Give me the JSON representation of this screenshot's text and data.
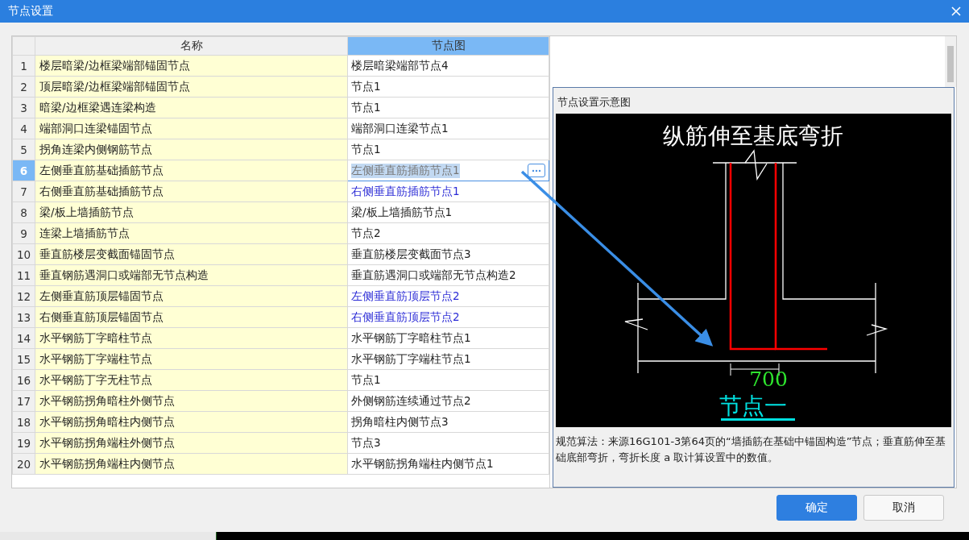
{
  "window": {
    "title": "节点设置"
  },
  "table": {
    "columns": [
      {
        "label": "名称",
        "selected": false
      },
      {
        "label": "节点图",
        "selected": true
      }
    ],
    "rows": [
      {
        "index": "1",
        "name": "楼层暗梁/边框梁端部锚固节点",
        "value": "楼层暗梁端部节点4",
        "modified": false,
        "selected": false
      },
      {
        "index": "2",
        "name": "顶层暗梁/边框梁端部锚固节点",
        "value": "节点1",
        "modified": false,
        "selected": false
      },
      {
        "index": "3",
        "name": "暗梁/边框梁遇连梁构造",
        "value": "节点1",
        "modified": false,
        "selected": false
      },
      {
        "index": "4",
        "name": "端部洞口连梁锚固节点",
        "value": "端部洞口连梁节点1",
        "modified": false,
        "selected": false
      },
      {
        "index": "5",
        "name": "拐角连梁内侧钢筋节点",
        "value": "节点1",
        "modified": false,
        "selected": false
      },
      {
        "index": "6",
        "name": "左侧垂直筋基础插筋节点",
        "value": "左侧垂直筋插筋节点1",
        "modified": false,
        "selected": true
      },
      {
        "index": "7",
        "name": "右侧垂直筋基础插筋节点",
        "value": "右侧垂直筋插筋节点1",
        "modified": true,
        "selected": false
      },
      {
        "index": "8",
        "name": "梁/板上墙插筋节点",
        "value": "梁/板上墙插筋节点1",
        "modified": false,
        "selected": false
      },
      {
        "index": "9",
        "name": "连梁上墙插筋节点",
        "value": "节点2",
        "modified": false,
        "selected": false
      },
      {
        "index": "10",
        "name": "垂直筋楼层变截面锚固节点",
        "value": "垂直筋楼层变截面节点3",
        "modified": false,
        "selected": false
      },
      {
        "index": "11",
        "name": "垂直钢筋遇洞口或端部无节点构造",
        "value": "垂直筋遇洞口或端部无节点构造2",
        "modified": false,
        "selected": false
      },
      {
        "index": "12",
        "name": "左侧垂直筋顶层锚固节点",
        "value": "左侧垂直筋顶层节点2",
        "modified": true,
        "selected": false
      },
      {
        "index": "13",
        "name": "右侧垂直筋顶层锚固节点",
        "value": "右侧垂直筋顶层节点2",
        "modified": true,
        "selected": false
      },
      {
        "index": "14",
        "name": "水平钢筋丁字暗柱节点",
        "value": "水平钢筋丁字暗柱节点1",
        "modified": false,
        "selected": false
      },
      {
        "index": "15",
        "name": "水平钢筋丁字端柱节点",
        "value": "水平钢筋丁字端柱节点1",
        "modified": false,
        "selected": false
      },
      {
        "index": "16",
        "name": "水平钢筋丁字无柱节点",
        "value": "节点1",
        "modified": false,
        "selected": false
      },
      {
        "index": "17",
        "name": "水平钢筋拐角暗柱外侧节点",
        "value": "外侧钢筋连续通过节点2",
        "modified": false,
        "selected": false
      },
      {
        "index": "18",
        "name": "水平钢筋拐角暗柱内侧节点",
        "value": "拐角暗柱内侧节点3",
        "modified": false,
        "selected": false
      },
      {
        "index": "19",
        "name": "水平钢筋拐角端柱外侧节点",
        "value": "节点3",
        "modified": false,
        "selected": false
      },
      {
        "index": "20",
        "name": "水平钢筋拐角端柱内侧节点",
        "value": "水平钢筋拐角端柱内侧节点1",
        "modified": false,
        "selected": false
      }
    ]
  },
  "preview": {
    "title": "节点设置示意图",
    "diagram": {
      "heading": "纵筋伸至基底弯折",
      "dimension": "700",
      "label": "节点一"
    },
    "description": "规范算法：来源16G101-3第64页的“墙插筋在基础中锚固构造”节点；垂直筋伸至基础底部弯折，弯折长度 a 取计算设置中的数值。"
  },
  "buttons": [
    {
      "label": "确定",
      "primary": true
    },
    {
      "label": "取消",
      "primary": false
    }
  ]
}
